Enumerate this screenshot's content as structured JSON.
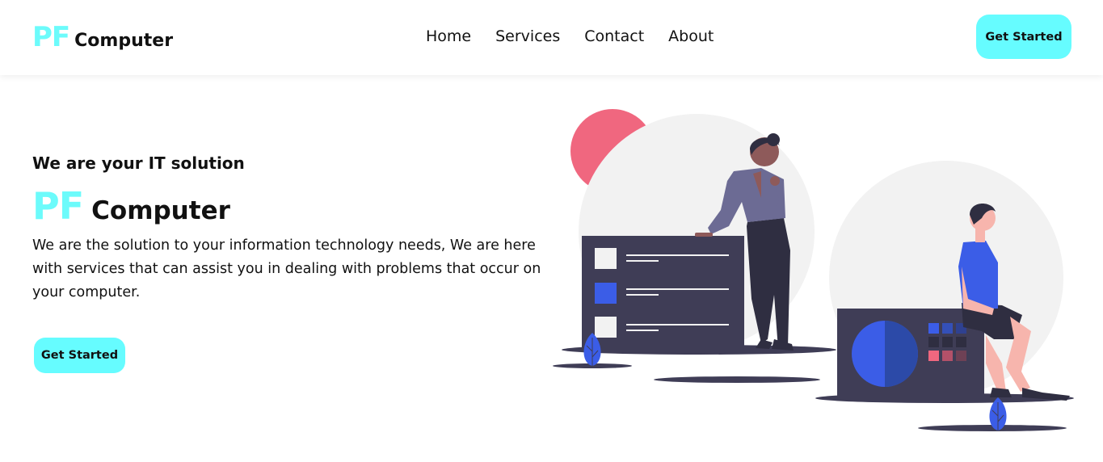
{
  "brand": {
    "pf": "PF",
    "name": "Computer"
  },
  "nav": {
    "items": [
      {
        "label": "Home"
      },
      {
        "label": "Services"
      },
      {
        "label": "Contact"
      },
      {
        "label": "About"
      }
    ],
    "cta_label": "Get Started"
  },
  "hero": {
    "subtitle": "We are your IT solution",
    "title_pf": "PF",
    "title_name": "Computer",
    "description": "We are the solution to your information technology needs, We are here with services that can assist you in dealing with problems that occur on your computer.",
    "cta_label": "Get Started"
  },
  "illustration": {
    "subject": "it-support-people-illustration"
  },
  "colors": {
    "accent": "#66fcff",
    "brand_pf": "#6cfbfb",
    "panel_dark": "#3f3d56",
    "blue": "#3b5de7",
    "pink": "#f0677f",
    "circle_gray": "#f2f2f2"
  }
}
